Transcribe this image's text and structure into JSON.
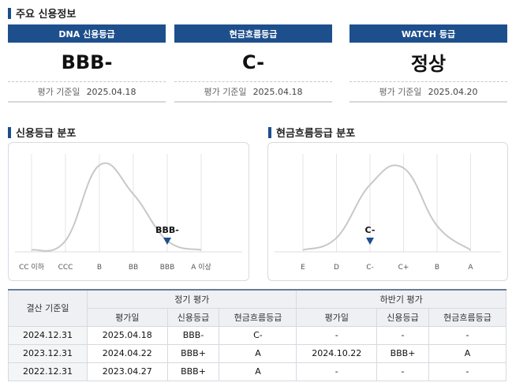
{
  "section_main": "주요 신용정보",
  "cards": [
    {
      "header": "DNA 신용등급",
      "value": "BBB-",
      "date_label": "평가 기준일",
      "date": "2025.04.18"
    },
    {
      "header": "현금흐름등급",
      "value": "C-",
      "date_label": "평가 기준일",
      "date": "2025.04.18"
    },
    {
      "header": "WATCH 등급",
      "value": "정상",
      "date_label": "평가 기준일",
      "date": "2025.04.20"
    }
  ],
  "section_dist_credit": "신용등급 분포",
  "section_dist_cash": "현금흐름등급 분포",
  "chart_data": [
    {
      "type": "line",
      "categories": [
        "CC 이하",
        "CCC",
        "B",
        "BB",
        "BBB",
        "A 이상"
      ],
      "series": [
        {
          "values": [
            0.02,
            0.12,
            0.93,
            0.62,
            0.12,
            0.02
          ]
        }
      ],
      "marker": {
        "category": "BBB",
        "label": "BBB-"
      },
      "grid": true
    },
    {
      "type": "line",
      "categories": [
        "E",
        "D",
        "C-",
        "C+",
        "B",
        "A"
      ],
      "series": [
        {
          "values": [
            0.02,
            0.15,
            0.72,
            0.9,
            0.28,
            0.02
          ]
        }
      ],
      "marker": {
        "category": "C-",
        "label": "C-"
      },
      "grid": true
    }
  ],
  "table": {
    "h_date": "결산 기준일",
    "h_regular": "정기 평가",
    "h_half": "하반기 평가",
    "sub_headers": [
      "평가일",
      "신용등급",
      "현금흐름등급",
      "평가일",
      "신용등급",
      "현금흐름등급"
    ],
    "rows": [
      [
        "2024.12.31",
        "2025.04.18",
        "BBB-",
        "C-",
        "-",
        "-",
        "-"
      ],
      [
        "2023.12.31",
        "2024.04.22",
        "BBB+",
        "A",
        "2024.10.22",
        "BBB+",
        "A"
      ],
      [
        "2022.12.31",
        "2023.04.27",
        "BBB+",
        "A",
        "-",
        "-",
        "-"
      ]
    ]
  },
  "colors": {
    "header_bg": "#1e4f8d",
    "marker": "#1e4f8d",
    "curve": "#c8c8c8"
  }
}
